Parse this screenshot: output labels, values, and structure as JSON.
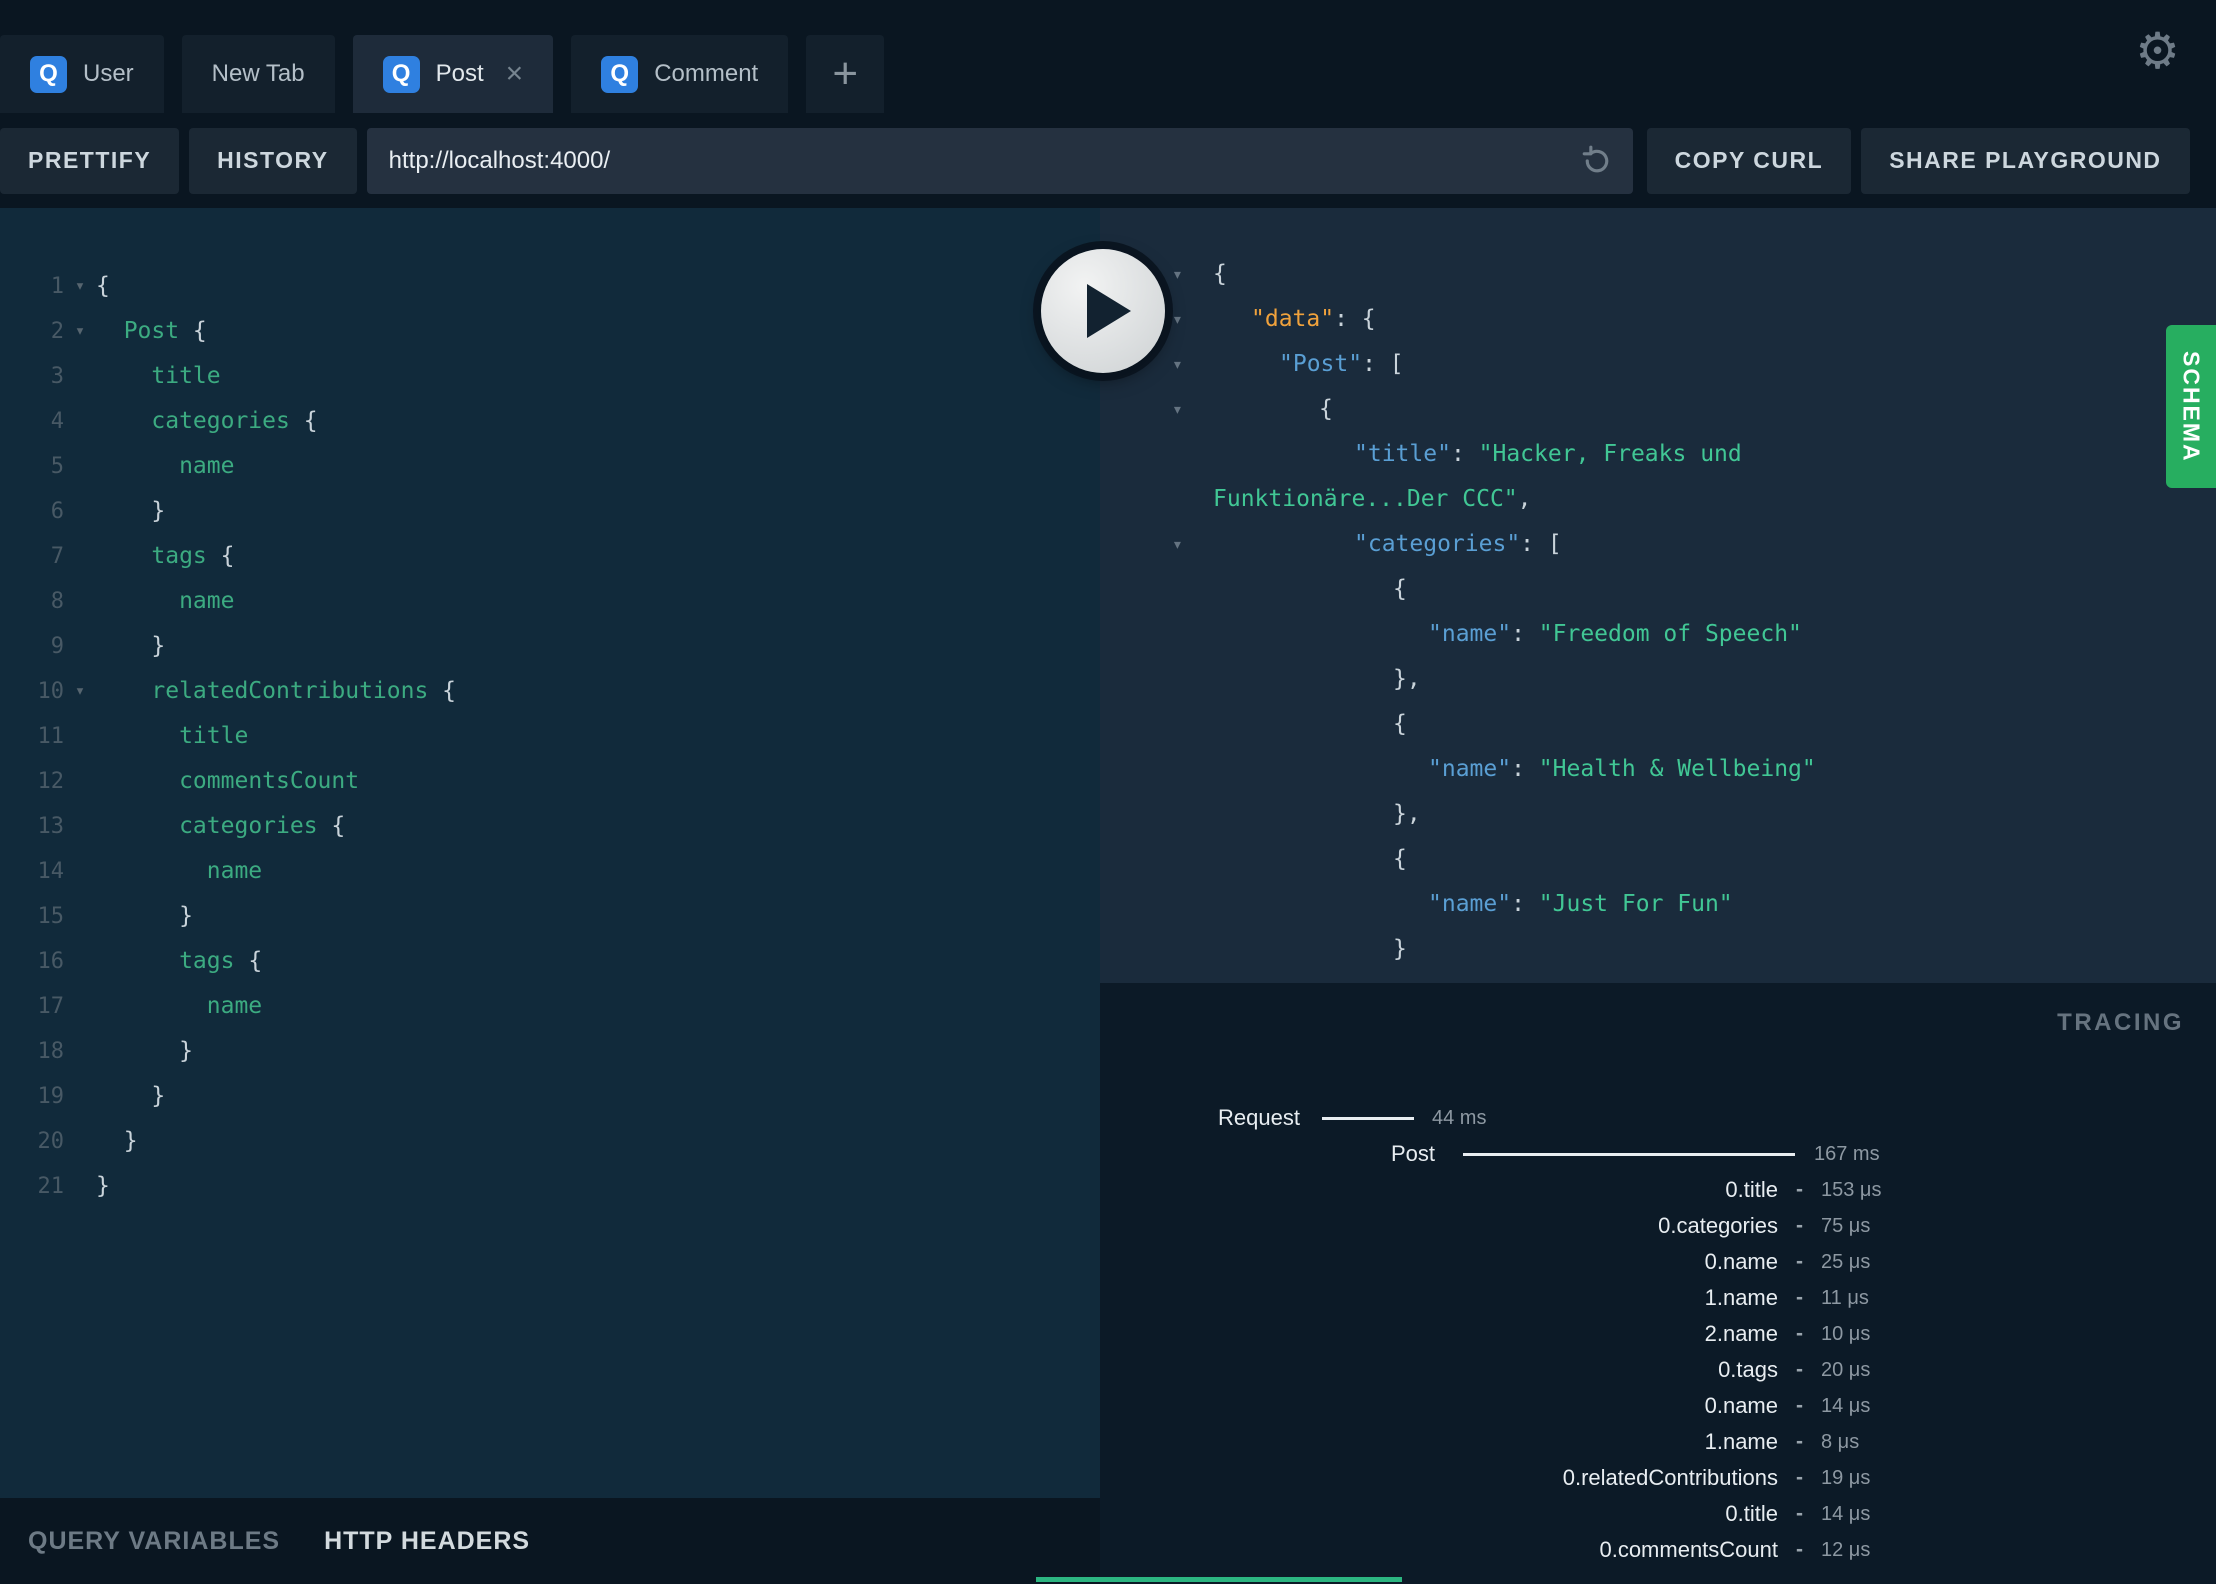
{
  "icons": {
    "gear": "⚙",
    "add": "+",
    "close": "×",
    "fold": "▾",
    "query_badge": "Q"
  },
  "tab_bar": {
    "tabs": [
      {
        "label": "User",
        "icon": "Q",
        "active": false,
        "closable": false
      },
      {
        "label": "New Tab",
        "icon": "",
        "active": false,
        "closable": false
      },
      {
        "label": "Post",
        "icon": "Q",
        "active": true,
        "closable": true
      },
      {
        "label": "Comment",
        "icon": "Q",
        "active": false,
        "closable": false
      }
    ]
  },
  "toolbar": {
    "prettify_label": "PRETTIFY",
    "history_label": "HISTORY",
    "url_value": "http://localhost:4000/",
    "copy_curl_label": "COPY CURL",
    "share_label": "SHARE PLAYGROUND"
  },
  "query_editor": {
    "lines": [
      {
        "num": 1,
        "fold": true,
        "indent": 0,
        "tokens": [
          [
            "p",
            "{"
          ]
        ]
      },
      {
        "num": 2,
        "fold": true,
        "indent": 2,
        "tokens": [
          [
            "f",
            "Post"
          ],
          [
            "p",
            " {"
          ]
        ]
      },
      {
        "num": 3,
        "fold": false,
        "indent": 4,
        "tokens": [
          [
            "f",
            "title"
          ]
        ]
      },
      {
        "num": 4,
        "fold": false,
        "indent": 4,
        "tokens": [
          [
            "f",
            "categories"
          ],
          [
            "p",
            " {"
          ]
        ]
      },
      {
        "num": 5,
        "fold": false,
        "indent": 6,
        "tokens": [
          [
            "f",
            "name"
          ]
        ]
      },
      {
        "num": 6,
        "fold": false,
        "indent": 4,
        "tokens": [
          [
            "p",
            "}"
          ]
        ]
      },
      {
        "num": 7,
        "fold": false,
        "indent": 4,
        "tokens": [
          [
            "f",
            "tags"
          ],
          [
            "p",
            " {"
          ]
        ]
      },
      {
        "num": 8,
        "fold": false,
        "indent": 6,
        "tokens": [
          [
            "f",
            "name"
          ]
        ]
      },
      {
        "num": 9,
        "fold": false,
        "indent": 4,
        "tokens": [
          [
            "p",
            "}"
          ]
        ]
      },
      {
        "num": 10,
        "fold": true,
        "indent": 4,
        "tokens": [
          [
            "f",
            "relatedContributions"
          ],
          [
            "p",
            " {"
          ]
        ]
      },
      {
        "num": 11,
        "fold": false,
        "indent": 6,
        "tokens": [
          [
            "f",
            "title"
          ]
        ]
      },
      {
        "num": 12,
        "fold": false,
        "indent": 6,
        "tokens": [
          [
            "f",
            "commentsCount"
          ]
        ]
      },
      {
        "num": 13,
        "fold": false,
        "indent": 6,
        "tokens": [
          [
            "f",
            "categories"
          ],
          [
            "p",
            " {"
          ]
        ]
      },
      {
        "num": 14,
        "fold": false,
        "indent": 8,
        "tokens": [
          [
            "f",
            "name"
          ]
        ]
      },
      {
        "num": 15,
        "fold": false,
        "indent": 6,
        "tokens": [
          [
            "p",
            "}"
          ]
        ]
      },
      {
        "num": 16,
        "fold": false,
        "indent": 6,
        "tokens": [
          [
            "f",
            "tags"
          ],
          [
            "p",
            " {"
          ]
        ]
      },
      {
        "num": 17,
        "fold": false,
        "indent": 8,
        "tokens": [
          [
            "f",
            "name"
          ]
        ]
      },
      {
        "num": 18,
        "fold": false,
        "indent": 6,
        "tokens": [
          [
            "p",
            "}"
          ]
        ]
      },
      {
        "num": 19,
        "fold": false,
        "indent": 4,
        "tokens": [
          [
            "p",
            "}"
          ]
        ]
      },
      {
        "num": 20,
        "fold": false,
        "indent": 2,
        "tokens": [
          [
            "p",
            "}"
          ]
        ]
      },
      {
        "num": 21,
        "fold": false,
        "indent": 0,
        "tokens": [
          [
            "p",
            "}"
          ]
        ]
      }
    ]
  },
  "response_viewer": {
    "schema_tab_label": "SCHEMA",
    "lines": [
      {
        "arrow": true,
        "level": 0,
        "tokens": [
          [
            "p",
            "{"
          ]
        ]
      },
      {
        "arrow": true,
        "level": 1,
        "tokens": [
          [
            "d",
            "\"data\""
          ],
          [
            "p",
            ": {"
          ]
        ]
      },
      {
        "arrow": true,
        "level": 2,
        "tokens": [
          [
            "k",
            "\"Post\""
          ],
          [
            "p",
            ": ["
          ]
        ]
      },
      {
        "arrow": true,
        "level": 3,
        "tokens": [
          [
            "p",
            "{"
          ]
        ]
      },
      {
        "arrow": false,
        "level": 4,
        "tokens": [
          [
            "k",
            "\"title\""
          ],
          [
            "p",
            ": "
          ],
          [
            "s",
            "\"Hacker, Freaks und"
          ]
        ]
      },
      {
        "arrow": false,
        "level": 0,
        "tokens": [
          [
            "s",
            "Funktionäre...Der CCC\""
          ],
          [
            "p",
            ","
          ]
        ]
      },
      {
        "arrow": true,
        "level": 4,
        "tokens": [
          [
            "k",
            "\"categories\""
          ],
          [
            "p",
            ": ["
          ]
        ]
      },
      {
        "arrow": false,
        "level": 5,
        "tokens": [
          [
            "p",
            "{"
          ]
        ]
      },
      {
        "arrow": false,
        "level": 6,
        "tokens": [
          [
            "k",
            "\"name\""
          ],
          [
            "p",
            ": "
          ],
          [
            "s",
            "\"Freedom of Speech\""
          ]
        ]
      },
      {
        "arrow": false,
        "level": 5,
        "tokens": [
          [
            "p",
            "},"
          ]
        ]
      },
      {
        "arrow": false,
        "level": 5,
        "tokens": [
          [
            "p",
            "{"
          ]
        ]
      },
      {
        "arrow": false,
        "level": 6,
        "tokens": [
          [
            "k",
            "\"name\""
          ],
          [
            "p",
            ": "
          ],
          [
            "s",
            "\"Health & Wellbeing\""
          ]
        ]
      },
      {
        "arrow": false,
        "level": 5,
        "tokens": [
          [
            "p",
            "},"
          ]
        ]
      },
      {
        "arrow": false,
        "level": 5,
        "tokens": [
          [
            "p",
            "{"
          ]
        ]
      },
      {
        "arrow": false,
        "level": 6,
        "tokens": [
          [
            "k",
            "\"name\""
          ],
          [
            "p",
            ": "
          ],
          [
            "s",
            "\"Just For Fun\""
          ]
        ]
      },
      {
        "arrow": false,
        "level": 5,
        "tokens": [
          [
            "p",
            "}"
          ]
        ]
      }
    ]
  },
  "tracing": {
    "title": "TRACING",
    "rows": [
      {
        "type": "request",
        "label": "Request",
        "time": "44 ms"
      },
      {
        "type": "post",
        "label": "Post",
        "time": "167 ms"
      },
      {
        "type": "field",
        "label": "0.title",
        "time": "153 μs"
      },
      {
        "type": "field",
        "label": "0.categories",
        "time": "75 μs"
      },
      {
        "type": "field",
        "label": "0.name",
        "time": "25 μs"
      },
      {
        "type": "field",
        "label": "1.name",
        "time": "11 μs"
      },
      {
        "type": "field",
        "label": "2.name",
        "time": "10 μs"
      },
      {
        "type": "field",
        "label": "0.tags",
        "time": "20 μs"
      },
      {
        "type": "field",
        "label": "0.name",
        "time": "14 μs"
      },
      {
        "type": "field",
        "label": "1.name",
        "time": "8 μs"
      },
      {
        "type": "field",
        "label": "0.relatedContributions",
        "time": "19 μs"
      },
      {
        "type": "field",
        "label": "0.title",
        "time": "14 μs"
      },
      {
        "type": "field",
        "label": "0.commentsCount",
        "time": "12 μs"
      }
    ]
  },
  "variables_bar": {
    "tabs": [
      {
        "label": "QUERY VARIABLES",
        "active": false
      },
      {
        "label": "HTTP HEADERS",
        "active": true
      }
    ]
  },
  "colors": {
    "accent_green": "#27ae60",
    "key_blue": "#5a9fd4",
    "data_orange": "#f0a23c",
    "string_green": "#41c795",
    "field_green": "#3cab81",
    "q_icon_blue": "#2f80e0"
  }
}
